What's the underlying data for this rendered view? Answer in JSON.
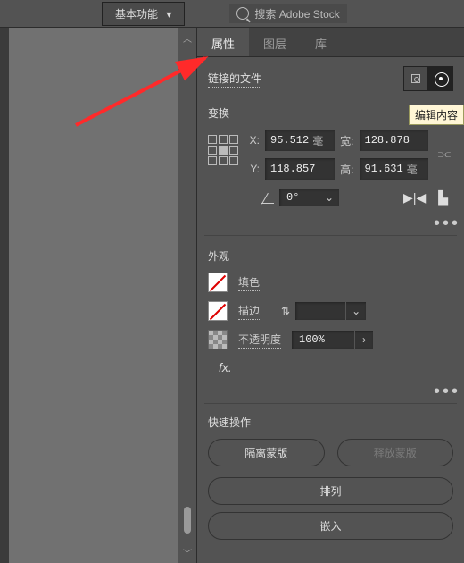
{
  "topbar": {
    "mode_label": "基本功能",
    "search_placeholder": "搜索 Adobe Stock"
  },
  "panel": {
    "tabs": [
      {
        "label": "属性",
        "active": true
      },
      {
        "label": "图层",
        "active": false
      },
      {
        "label": "库",
        "active": false
      }
    ],
    "link_label": "链接的文件",
    "tooltip": "编辑内容"
  },
  "transform": {
    "title": "变换",
    "labels": {
      "x": "X:",
      "y": "Y:",
      "w": "宽:",
      "h": "高:"
    },
    "x": "95.512",
    "w": "128.878",
    "y": "118.857",
    "h": "91.631",
    "unit": "毫",
    "rotation": "0°"
  },
  "appearance": {
    "title": "外观",
    "fill_label": "填色",
    "stroke_label": "描边",
    "opacity_label": "不透明度",
    "opacity_value": "100%",
    "fx_label": "fx."
  },
  "quick": {
    "title": "快速操作",
    "btn1": "隔离蒙版",
    "btn2": "释放蒙版",
    "btn3": "排列",
    "btn4": "嵌入"
  }
}
